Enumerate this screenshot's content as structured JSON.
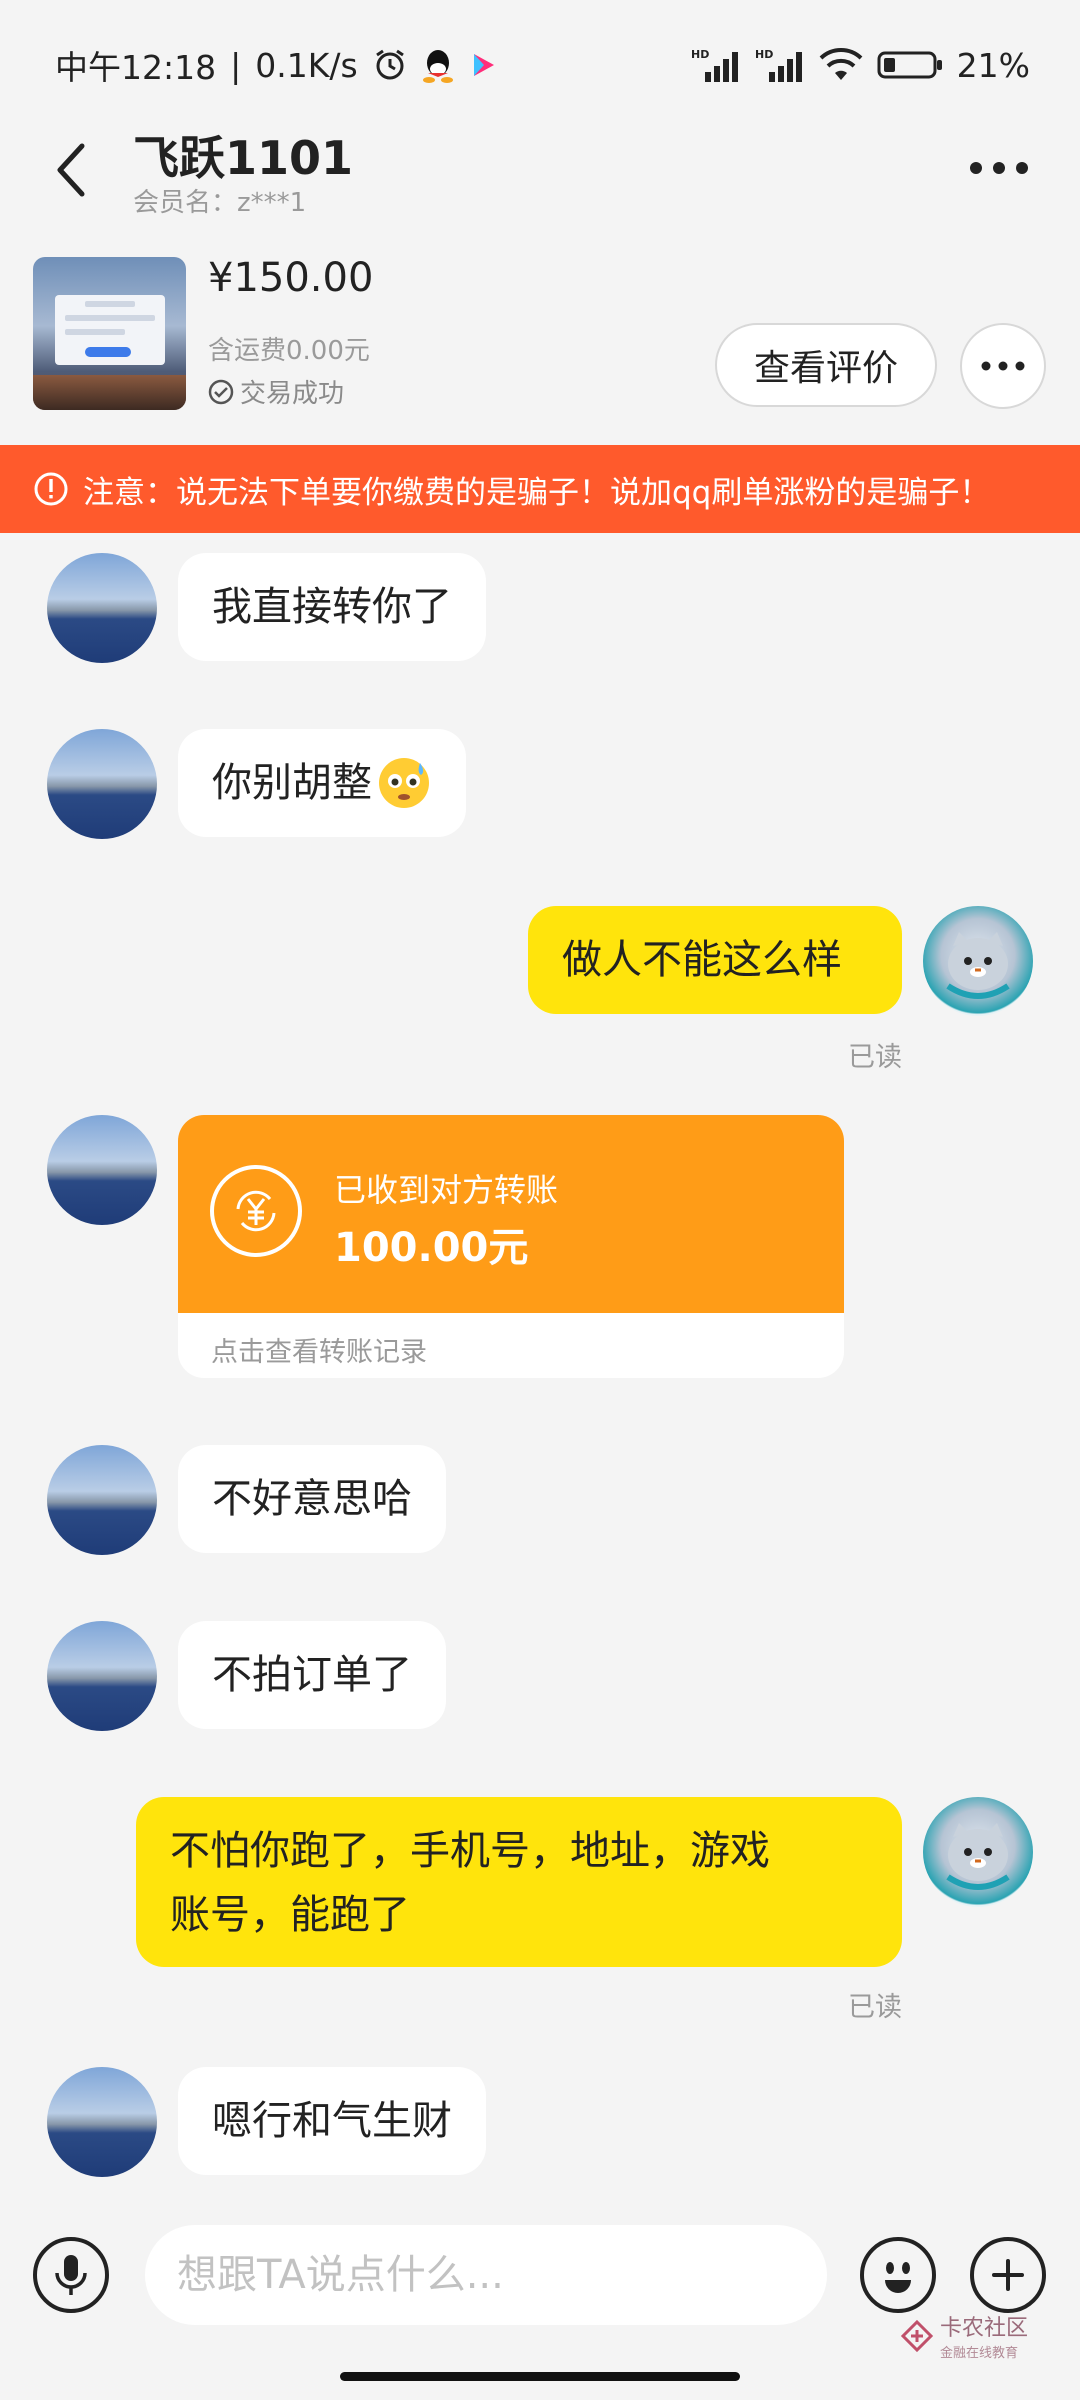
{
  "status_bar": {
    "time": "中午12:18",
    "separator": "|",
    "speed": "0.1K/s",
    "network_1": "HD",
    "network_2": "HD",
    "battery": "21%",
    "icons": [
      "alarm-icon",
      "qq-icon",
      "video-app-icon",
      "signal-icon",
      "wifi-icon",
      "battery-icon"
    ]
  },
  "header": {
    "title": "飞跃1101",
    "subtitle": "会员名：z***1"
  },
  "item": {
    "price": "¥150.00",
    "shipping": "含运费0.00元",
    "status": "交易成功",
    "review_label": "查看评价"
  },
  "warning": {
    "text": "注意：说无法下单要你缴费的是骗子！说加qq刷单涨粉的是骗子！"
  },
  "messages": [
    {
      "from": "other",
      "text": "我直接转你了"
    },
    {
      "from": "other",
      "text": "你别胡整"
    },
    {
      "from": "me",
      "text": "做人不能这么样",
      "read": "已读"
    },
    {
      "from": "other",
      "type": "transfer",
      "label": "已收到对方转账",
      "amount": "100.00元",
      "footer": "点击查看转账记录"
    },
    {
      "from": "other",
      "text": "不好意思哈"
    },
    {
      "from": "other",
      "text": "不拍订单了"
    },
    {
      "from": "me",
      "text_line1": "不怕你跑了，手机号，地址，游戏",
      "text_line2": "账号，能跑了",
      "read": "已读"
    },
    {
      "from": "other",
      "text": "嗯行和气生财"
    }
  ],
  "input": {
    "placeholder": "想跟TA说点什么..."
  },
  "watermark": {
    "name": "卡农社区",
    "tagline": "金融在线教育"
  },
  "colors": {
    "warning_bg": "#ff5a2c",
    "my_bubble": "#ffe40c",
    "transfer_bg": "#ff9c17",
    "page_bg": "#f4f4f4"
  }
}
